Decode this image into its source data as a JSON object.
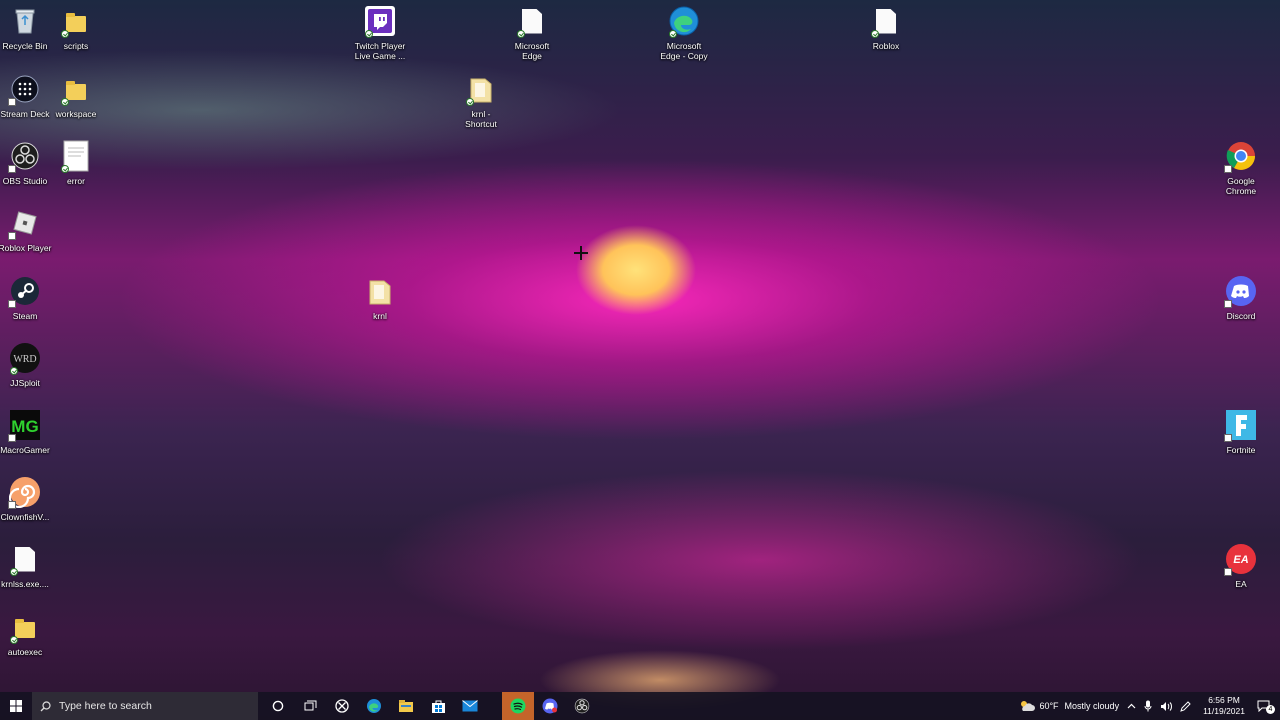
{
  "desktop_icons": [
    {
      "label": "Recycle Bin",
      "icon": "recycle-bin-icon"
    },
    {
      "label": "scripts",
      "icon": "folder-icon"
    },
    {
      "label": "Twitch Player\nLive Game ...",
      "icon": "twitch-icon"
    },
    {
      "label": "Microsoft\nEdge",
      "icon": "file-icon"
    },
    {
      "label": "Microsoft\nEdge - Copy",
      "icon": "edge-icon"
    },
    {
      "label": "Roblox",
      "icon": "file-icon"
    },
    {
      "label": "Stream Deck",
      "icon": "stream-deck-icon"
    },
    {
      "label": "workspace",
      "icon": "folder-icon"
    },
    {
      "label": "krnl -\nShortcut",
      "icon": "folder-shortcut-icon"
    },
    {
      "label": "OBS Studio",
      "icon": "obs-icon"
    },
    {
      "label": "error",
      "icon": "document-icon"
    },
    {
      "label": "Google\nChrome",
      "icon": "chrome-icon"
    },
    {
      "label": "Roblox Player",
      "icon": "roblox-icon"
    },
    {
      "label": "Steam",
      "icon": "steam-icon"
    },
    {
      "label": "krnl",
      "icon": "folder-icon"
    },
    {
      "label": "Discord",
      "icon": "discord-icon"
    },
    {
      "label": "JJSploit",
      "icon": "jjsploit-icon"
    },
    {
      "label": "MacroGamer",
      "icon": "macrogamer-icon"
    },
    {
      "label": "Fortnite",
      "icon": "fortnite-icon"
    },
    {
      "label": "ClownfishV...",
      "icon": "clownfish-icon"
    },
    {
      "label": "EA",
      "icon": "ea-icon"
    },
    {
      "label": "krnlss.exe....",
      "icon": "file-icon"
    },
    {
      "label": "autoexec",
      "icon": "folder-icon"
    }
  ],
  "taskbar": {
    "search_placeholder": "Type here to search",
    "pinned": [
      "start-icon",
      "cortana-icon",
      "task-view-icon",
      "xbox-icon",
      "edge-icon",
      "file-explorer-icon",
      "store-icon",
      "mail-icon",
      "spotify-icon",
      "discord-icon",
      "obs-icon"
    ],
    "weather_temp": "60°F",
    "weather_text": "Mostly cloudy",
    "time": "6:56 PM",
    "date": "11/19/2021",
    "notification_count": "4"
  },
  "colors": {
    "taskbar": "#16122a",
    "search_bg": "#2e2b36",
    "active_app": "#c4642a"
  }
}
